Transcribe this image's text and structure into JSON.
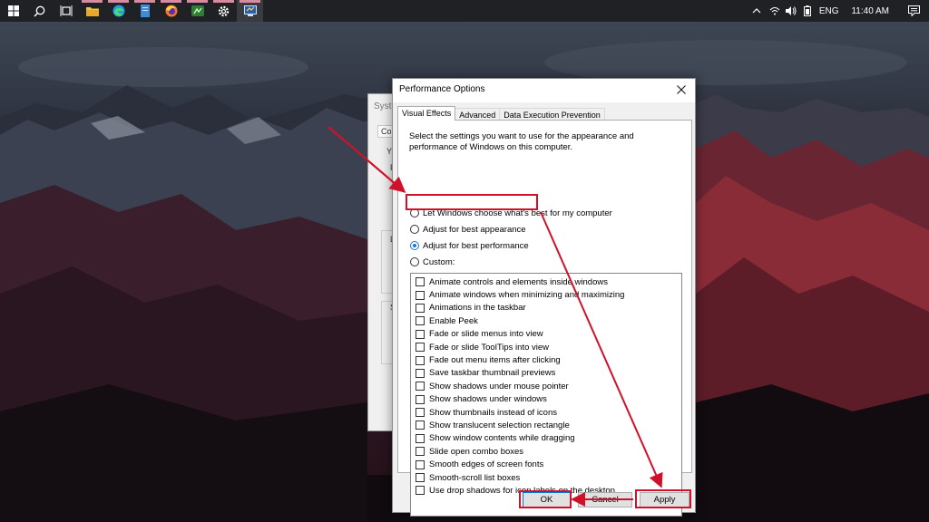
{
  "taskbar": {
    "apps": [
      {
        "icon": "windows-start-icon",
        "open": false
      },
      {
        "icon": "search-icon",
        "open": false
      },
      {
        "icon": "task-view-icon",
        "open": false
      },
      {
        "icon": "file-explorer-icon",
        "open": true
      },
      {
        "icon": "edge-browser-icon",
        "open": true
      },
      {
        "icon": "notepad-icon",
        "open": true
      },
      {
        "icon": "firefox-icon",
        "open": true
      },
      {
        "icon": "network-app-icon",
        "open": true
      },
      {
        "icon": "settings-gear-icon",
        "open": true
      },
      {
        "icon": "system-properties-icon",
        "open": true
      }
    ],
    "tray": {
      "language": "ENG",
      "time": "11:40 AM"
    }
  },
  "background_window": {
    "title": "Syste",
    "tab_fragment": "Com",
    "text_fragments": [
      "Y",
      "F",
      "L",
      "S"
    ]
  },
  "dialog": {
    "title": "Performance Options",
    "tabs": [
      "Visual Effects",
      "Advanced",
      "Data Execution Prevention"
    ],
    "selected_tab": "Visual Effects",
    "description": "Select the settings you want to use for the appearance and performance of Windows on this computer.",
    "radios": [
      {
        "label": "Let Windows choose what's best for my computer",
        "checked": false
      },
      {
        "label": "Adjust for best appearance",
        "checked": false
      },
      {
        "label": "Adjust for best performance",
        "checked": true
      },
      {
        "label": "Custom:",
        "checked": false
      }
    ],
    "effects": [
      "Animate controls and elements inside windows",
      "Animate windows when minimizing and maximizing",
      "Animations in the taskbar",
      "Enable Peek",
      "Fade or slide menus into view",
      "Fade or slide ToolTips into view",
      "Fade out menu items after clicking",
      "Save taskbar thumbnail previews",
      "Show shadows under mouse pointer",
      "Show shadows under windows",
      "Show thumbnails instead of icons",
      "Show translucent selection rectangle",
      "Show window contents while dragging",
      "Slide open combo boxes",
      "Smooth edges of screen fonts",
      "Smooth-scroll list boxes",
      "Use drop shadows for icon labels on the desktop"
    ],
    "buttons": {
      "ok": "OK",
      "cancel": "Cancel",
      "apply": "Apply"
    }
  },
  "annotation": {
    "highlight_color": "#d0112b"
  },
  "colors": {
    "taskbar_bg": "#202124",
    "dialog_bg": "#f0f0f0",
    "accent": "#1a73e8"
  }
}
